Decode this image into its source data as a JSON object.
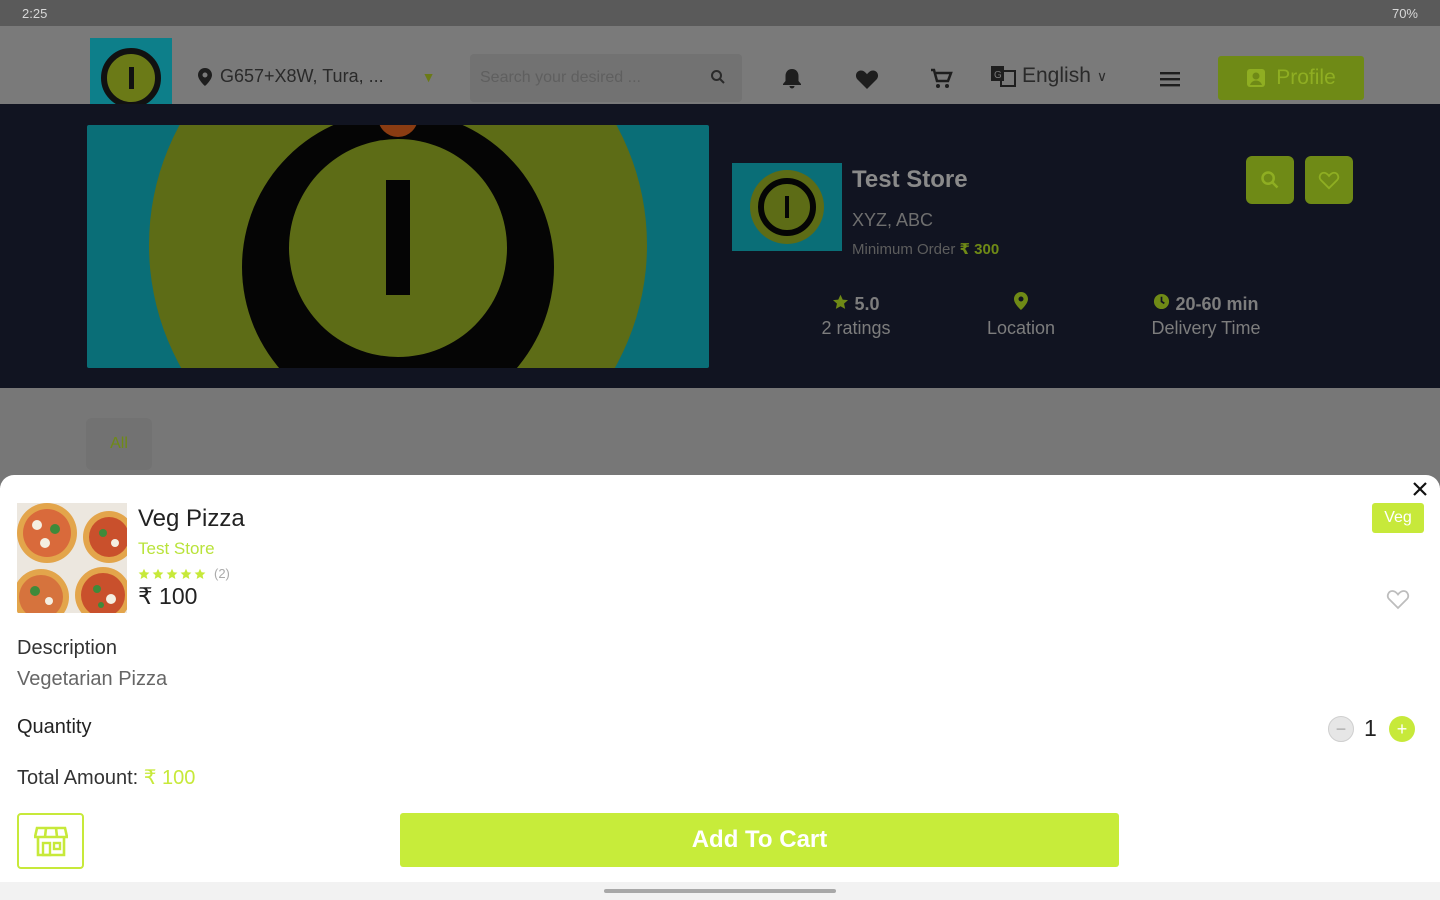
{
  "status_bar": {
    "time": "2:25",
    "right": "70%"
  },
  "header": {
    "location": "G657+X8W, Tura, ...",
    "search_placeholder": "Search your desired ...",
    "language": "English",
    "profile_label": "Profile",
    "icons": [
      "bell-icon",
      "heart-icon",
      "cart-icon",
      "translate-icon",
      "menu-icon",
      "user-icon"
    ]
  },
  "store": {
    "name": "Test Store",
    "address": "XYZ, ABC",
    "min_order_label": "Minimum Order",
    "min_order_amount": "₹ 300",
    "rating_value": "5.0",
    "rating_label": "2 ratings",
    "location_label": "Location",
    "delivery_value": "20-60 min",
    "delivery_label": "Delivery Time"
  },
  "category": {
    "all_label": "All"
  },
  "product": {
    "name": "Veg Pizza",
    "store": "Test Store",
    "rating_count": "(2)",
    "stars": 5,
    "price": "₹ 100",
    "badge": "Veg",
    "description_label": "Description",
    "description": "Vegetarian Pizza",
    "quantity_label": "Quantity",
    "quantity": "1",
    "minus_symbol": "−",
    "plus_symbol": "+",
    "total_label": "Total Amount:",
    "total_amount": "₹ 100",
    "add_to_cart": "Add To Cart"
  },
  "colors": {
    "accent": "#c7ec3a",
    "dark_hero": "#111421"
  }
}
